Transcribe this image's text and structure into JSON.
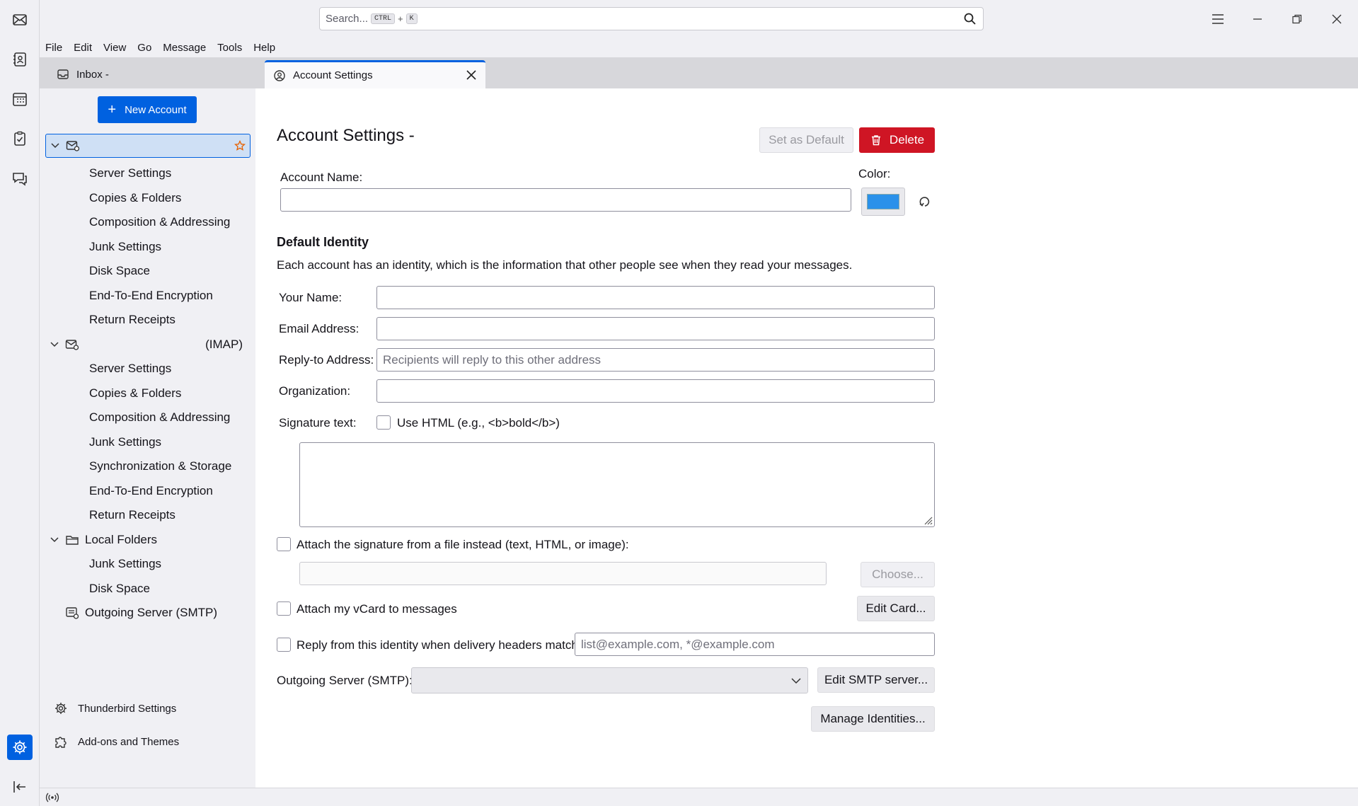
{
  "search": {
    "placeholder": "Search...",
    "key_mod": "CTRL",
    "key_plus": "+",
    "key_letter": "K"
  },
  "menu": [
    "File",
    "Edit",
    "View",
    "Go",
    "Message",
    "Tools",
    "Help"
  ],
  "tabs": {
    "inbox": "Inbox - ",
    "account_settings": "Account Settings"
  },
  "sidebar": {
    "new_account": "New Account",
    "account1_label": "",
    "account1_children": [
      "Server Settings",
      "Copies & Folders",
      "Composition & Addressing",
      "Junk Settings",
      "Disk Space",
      "End-To-End Encryption",
      "Return Receipts"
    ],
    "account2_suffix": "(IMAP)",
    "account2_children": [
      "Server Settings",
      "Copies & Folders",
      "Composition & Addressing",
      "Junk Settings",
      "Synchronization & Storage",
      "End-To-End Encryption",
      "Return Receipts"
    ],
    "local_folders": "Local Folders",
    "local_children": [
      "Junk Settings",
      "Disk Space"
    ],
    "outgoing_server": "Outgoing Server (SMTP)",
    "thunderbird_settings": "Thunderbird Settings",
    "addons_themes": "Add-ons and Themes"
  },
  "main": {
    "title": "Account Settings -",
    "set_default": "Set as Default",
    "delete": "Delete",
    "account_name_label": "Account Name:",
    "account_name_value": "",
    "color_label": "Color:",
    "account_color": "#2a91ea",
    "default_identity": "Default Identity",
    "identity_desc": "Each account has an identity, which is the information that other people see when they read your messages.",
    "your_name_label": "Your Name:",
    "your_name_value": "",
    "email_label": "Email Address:",
    "email_value": "",
    "reply_to_label": "Reply-to Address:",
    "reply_to_placeholder": "Recipients will reply to this other address",
    "organization_label": "Organization:",
    "organization_value": "",
    "signature_label": "Signature text:",
    "use_html": "Use HTML (e.g., <b>bold</b>)",
    "attach_sig_file": "Attach the signature from a file instead (text, HTML, or image):",
    "choose": "Choose...",
    "attach_vcard": "Attach my vCard to messages",
    "edit_card": "Edit Card...",
    "reply_from_identity": "Reply from this identity when delivery headers match:",
    "reply_from_placeholder": "list@example.com, *@example.com",
    "outgoing_label": "Outgoing Server (SMTP):",
    "outgoing_value": "",
    "edit_smtp": "Edit SMTP server...",
    "manage_identities": "Manage Identities..."
  }
}
